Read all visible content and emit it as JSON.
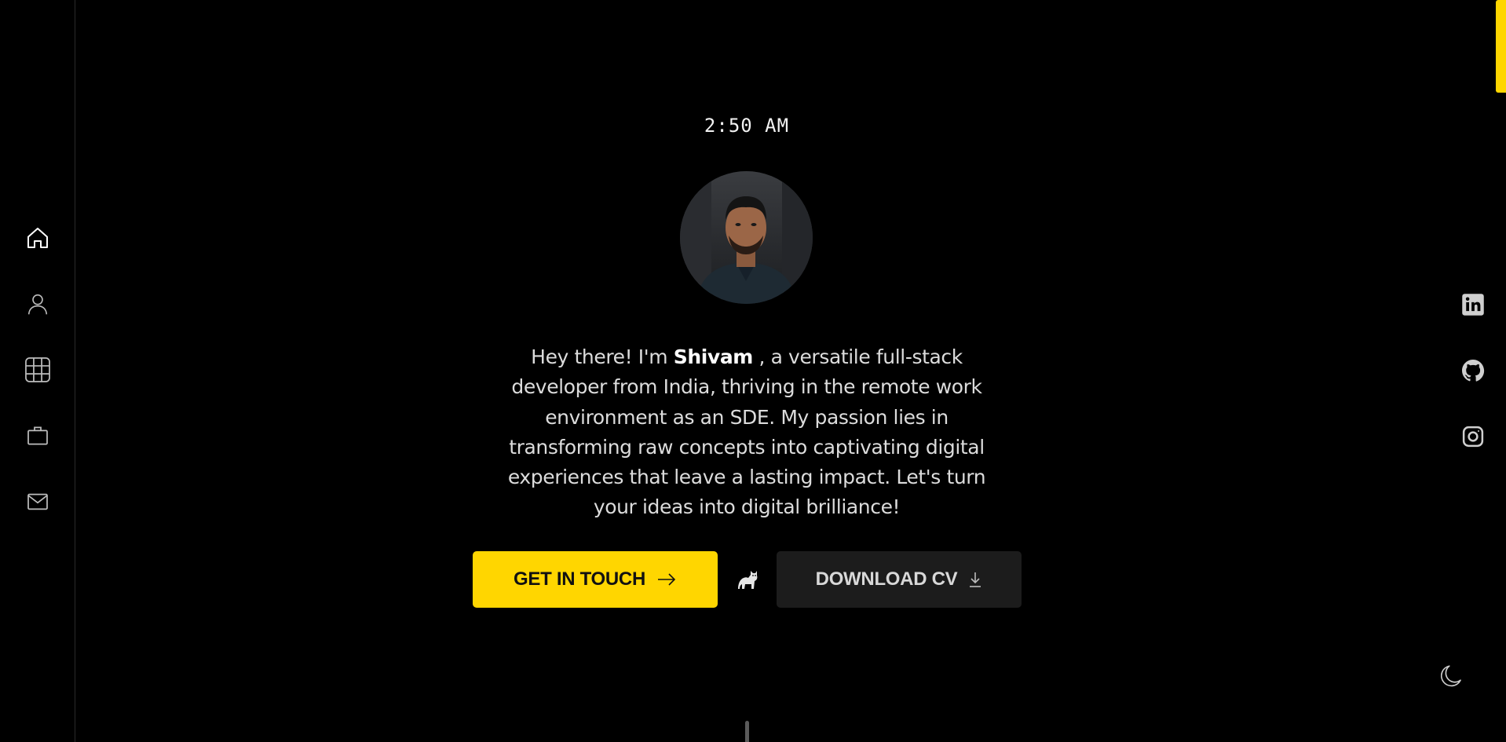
{
  "nav": {
    "items": [
      {
        "icon": "home-icon",
        "label": "Home"
      },
      {
        "icon": "user-icon",
        "label": "About"
      },
      {
        "icon": "grid-icon",
        "label": "Projects"
      },
      {
        "icon": "briefcase-icon",
        "label": "Experience"
      },
      {
        "icon": "mail-icon",
        "label": "Contact"
      }
    ]
  },
  "hero": {
    "time": "2:50 AM",
    "intro_prefix": "Hey there! I'm ",
    "name": "Shivam",
    "intro_suffix": " , a versatile full-stack developer from India, thriving in the remote work environment as an SDE. My passion lies in transforming raw concepts into captivating digital experiences that leave a lasting impact. Let's turn your ideas into digital brilliance!",
    "primary_button": "GET IN TOUCH",
    "secondary_button": "DOWNLOAD CV"
  },
  "social": {
    "items": [
      {
        "icon": "linkedin-icon",
        "label": "LinkedIn"
      },
      {
        "icon": "github-icon",
        "label": "GitHub"
      },
      {
        "icon": "instagram-icon",
        "label": "Instagram"
      }
    ]
  },
  "colors": {
    "background": "#000000",
    "accent": "#ffd600",
    "secondary_button_bg": "#1c1c1c",
    "text": "#dcdcdc"
  }
}
